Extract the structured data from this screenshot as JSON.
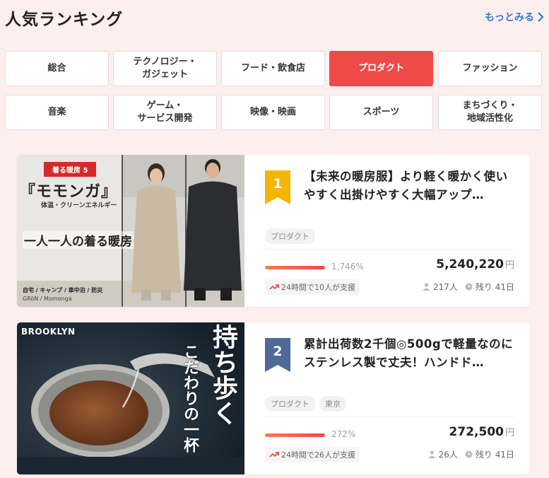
{
  "header": {
    "title": "人気ランキング",
    "more_label": "もっとみる"
  },
  "tabs": [
    {
      "label": "総合",
      "active": false
    },
    {
      "label": "テクノロジー・\nガジェット",
      "active": false
    },
    {
      "label": "フード・飲食店",
      "active": false
    },
    {
      "label": "プロダクト",
      "active": true
    },
    {
      "label": "ファッション",
      "active": false
    },
    {
      "label": "音楽",
      "active": false
    },
    {
      "label": "ゲーム・\nサービス開発",
      "active": false
    },
    {
      "label": "映像・映画",
      "active": false
    },
    {
      "label": "スポーツ",
      "active": false
    },
    {
      "label": "まちづくり・\n地域活性化",
      "active": false
    }
  ],
  "colors": {
    "accent": "#ef4a48",
    "link": "#2f7ad6",
    "rank1": "#f5b400",
    "rank2": "#4e6a96"
  },
  "cards": [
    {
      "rank": "1",
      "title": "【未来の暖房服】より軽く暖かく使いやすく出掛けやすく大幅アップ…",
      "tags": [
        "プロダクト"
      ],
      "progress_pct": 100,
      "percent_text": "1,746%",
      "amount": "5,240,220",
      "currency": "円",
      "support_text": "24時間で10人が支援",
      "backers": "217人",
      "remaining": "残り 41日",
      "thumb": {
        "badge": "着る暖房 5",
        "headline": "『モモンガ』",
        "sub": "体温・クリーンエネルギー",
        "tagline": "一人一人の着る暖房",
        "uses": "自宅 / キャンプ / 車中泊 / 防災",
        "brand": "GRöN / Momonga"
      }
    },
    {
      "rank": "2",
      "title": "累計出荷数2千個◎500gで軽量なのにステンレス製で丈夫！ハンドド…",
      "tags": [
        "プロダクト",
        "東京"
      ],
      "progress_pct": 100,
      "percent_text": "272%",
      "amount": "272,500",
      "currency": "円",
      "support_text": "24時間で26人が支援",
      "backers": "26人",
      "remaining": "残り 41日",
      "thumb": {
        "brand": "BROOKLYN",
        "headline": "持ち歩く",
        "sub": "こだわりの一杯"
      }
    }
  ]
}
